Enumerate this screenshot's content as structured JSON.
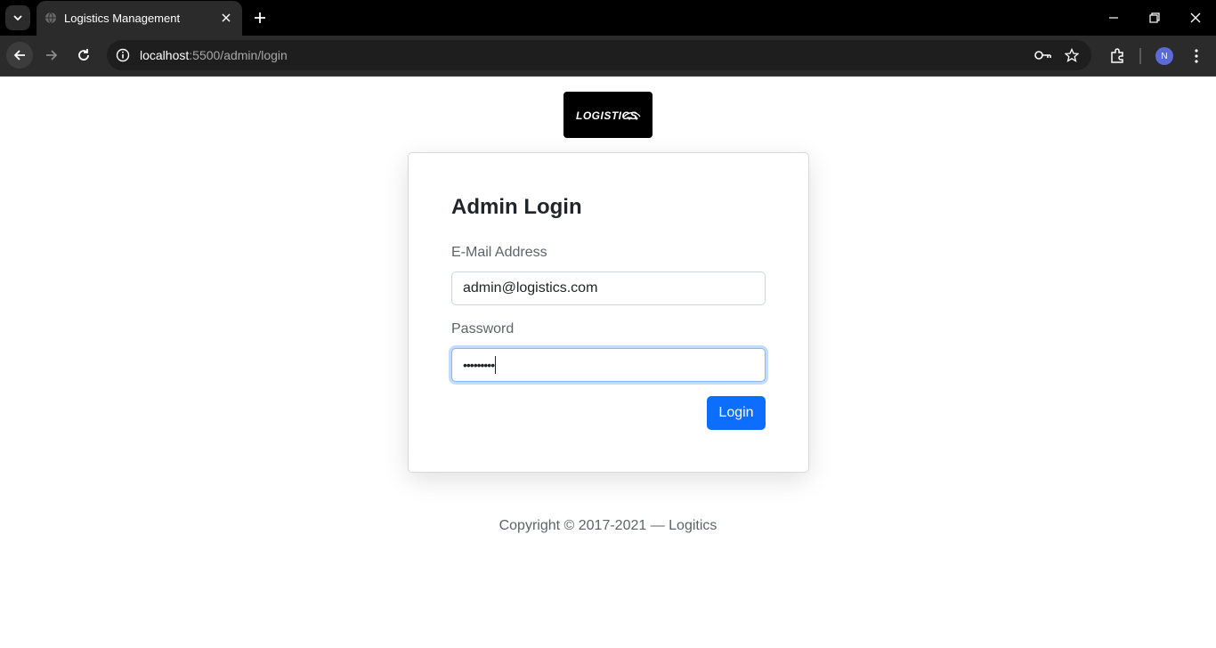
{
  "browser": {
    "tab_title": "Logistics Management",
    "url_host": "localhost",
    "url_path": ":5500/admin/login",
    "profile_initial": "N"
  },
  "page": {
    "logo_text": "LOGISTICS",
    "heading": "Admin Login",
    "email_label": "E-Mail Address",
    "email_value": "admin@logistics.com",
    "password_label": "Password",
    "password_mask": "•••••••••",
    "login_button": "Login",
    "footer": "Copyright © 2017-2021 — Logitics"
  },
  "colors": {
    "primary": "#0d6efd",
    "focus_ring": "#86b7fe"
  }
}
